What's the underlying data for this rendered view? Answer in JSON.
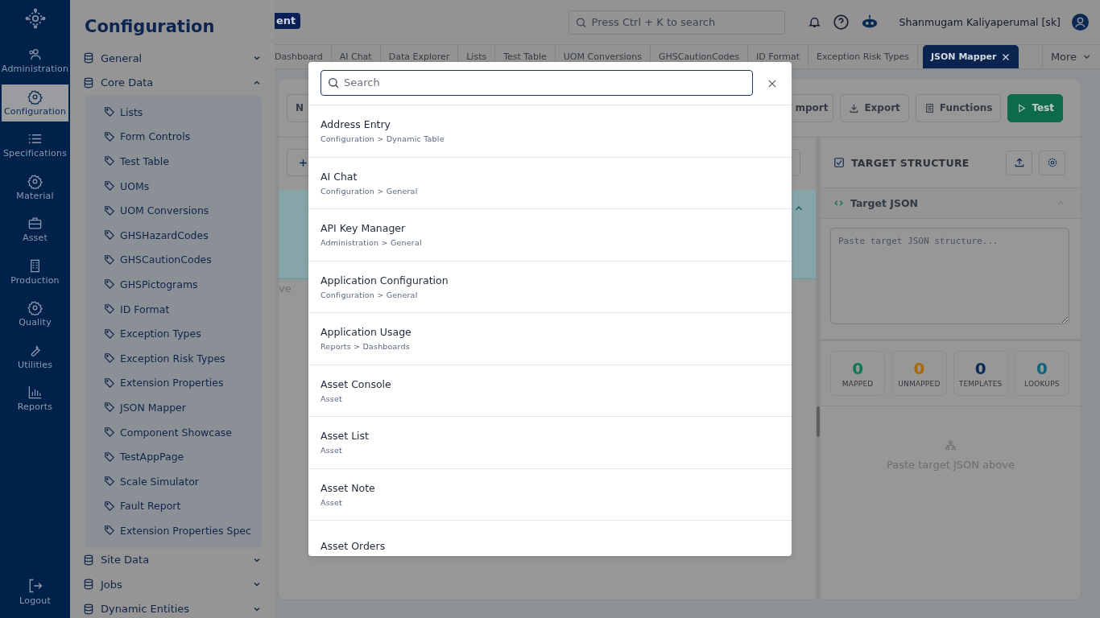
{
  "rail": {
    "items": [
      {
        "label": "Administration",
        "selected": false
      },
      {
        "label": "Configuration",
        "selected": true
      },
      {
        "label": "Specifications",
        "selected": false
      },
      {
        "label": "Material",
        "selected": false
      },
      {
        "label": "Asset",
        "selected": false
      },
      {
        "label": "Production",
        "selected": false
      },
      {
        "label": "Quality",
        "selected": false
      },
      {
        "label": "Utilities",
        "selected": false
      },
      {
        "label": "Reports",
        "selected": false
      }
    ],
    "logout": "Logout"
  },
  "config": {
    "title": "Configuration",
    "groups": [
      {
        "label": "General",
        "expanded": false
      },
      {
        "label": "Core Data",
        "expanded": true,
        "children": [
          "Lists",
          "Form Controls",
          "Test Table",
          "UOMs",
          "UOM Conversions",
          "GHSHazardCodes",
          "GHSCautionCodes",
          "GHSPictograms",
          "ID Format",
          "Exception Types",
          "Exception Risk Types",
          "Extension Properties",
          "JSON Mapper",
          "Component Showcase",
          "TestAppPage",
          "Scale Simulator",
          "Fault Report",
          "Extension Properties Spec"
        ]
      },
      {
        "label": "Site Data",
        "expanded": false
      },
      {
        "label": "Jobs",
        "expanded": false
      },
      {
        "label": "Dynamic Entities",
        "expanded": false
      }
    ]
  },
  "topbar": {
    "badge": "ent",
    "search": {
      "placeholder": "Press Ctrl + K to search"
    },
    "user": "Shanmugam Kaliyaperumal [sk]"
  },
  "tabs": [
    {
      "label": "Dashboard",
      "selected": false
    },
    {
      "label": "AI Chat",
      "selected": false
    },
    {
      "label": "Data Explorer",
      "selected": false
    },
    {
      "label": "Lists",
      "selected": false
    },
    {
      "label": "Test Table",
      "selected": false
    },
    {
      "label": "UOM Conversions",
      "selected": false
    },
    {
      "label": "GHSCautionCodes",
      "selected": false
    },
    {
      "label": "ID Format",
      "selected": false
    },
    {
      "label": "Exception Risk Types",
      "selected": false
    },
    {
      "label": "JSON Mapper",
      "selected": true
    }
  ],
  "more": "More",
  "toolbar": {
    "left": "N",
    "right": [
      {
        "label": "mport",
        "kind": "outline"
      },
      {
        "label": "Export",
        "kind": "outline"
      },
      {
        "label": "Functions",
        "kind": "outline"
      },
      {
        "label": "Test",
        "kind": "primary"
      }
    ]
  },
  "source": {
    "hint": "ve"
  },
  "target": {
    "title": "TARGET STRUCTURE",
    "section": "Target JSON",
    "expanded": true,
    "placeholder": "Paste target JSON structure...",
    "stats": [
      {
        "value": "0",
        "label": "MAPPED",
        "color": "#0e7a55"
      },
      {
        "value": "0",
        "label": "UNMAPPED",
        "color": "#a86a06"
      },
      {
        "value": "0",
        "label": "TEMPLATES",
        "color": "#0b2a55"
      },
      {
        "value": "0",
        "label": "LOOKUPS",
        "color": "#0d6577"
      }
    ],
    "empty": "Paste target JSON above"
  },
  "modal": {
    "search": {
      "placeholder": "Search"
    },
    "results": [
      {
        "title": "Address Entry",
        "path": "Configuration > Dynamic Table"
      },
      {
        "title": "AI Chat",
        "path": "Configuration > General"
      },
      {
        "title": "API Key Manager",
        "path": "Administration > General"
      },
      {
        "title": "Application Configuration",
        "path": "Configuration > General"
      },
      {
        "title": "Application Usage",
        "path": "Reports > Dashboards"
      },
      {
        "title": "Asset Console",
        "path": "Asset"
      },
      {
        "title": "Asset List",
        "path": "Asset"
      },
      {
        "title": "Asset Note",
        "path": "Asset"
      },
      {
        "title": "Asset Orders"
      }
    ]
  }
}
